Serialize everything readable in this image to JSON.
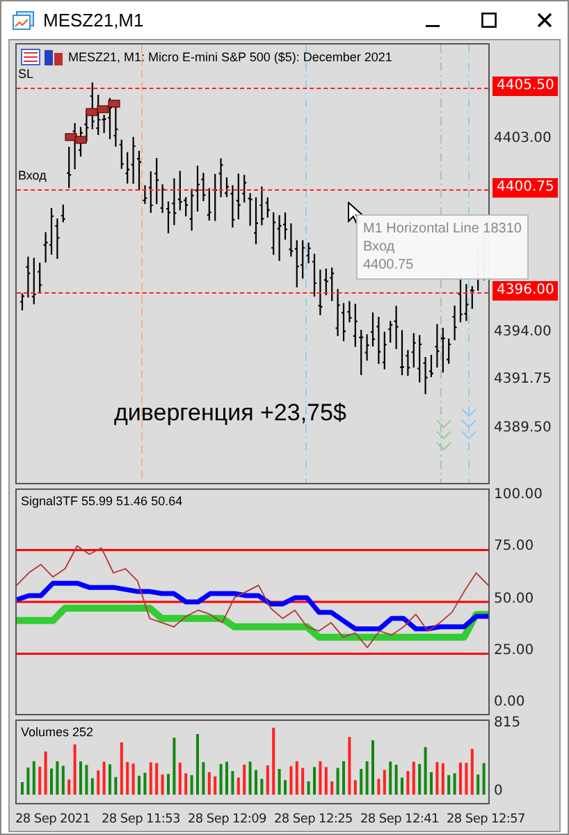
{
  "window": {
    "title": "MESZ21,M1"
  },
  "chart": {
    "header": "MESZ21, M1:  Micro E-mini S&P 500 ($5): December 2021",
    "price_ticks": [
      "4403.00",
      "4394.00",
      "4391.75",
      "4389.50"
    ],
    "lines": [
      {
        "label": "SL",
        "price": "4405.50"
      },
      {
        "label": "Вход",
        "price": "4400.75"
      },
      {
        "price": "4396.00"
      }
    ],
    "tooltip": [
      "M1 Horizontal Line 18310",
      "Вход",
      "4400.75"
    ],
    "annotation": "дивергенция +23,75$"
  },
  "indicator": {
    "chart_data": {
      "type": "line",
      "title": "Signal3TF 55.99 51.46 50.64",
      "grid": true,
      "ylim": [
        -4,
        104
      ],
      "yticks": [
        {
          "value": 100,
          "label": "100.00"
        },
        {
          "value": 75,
          "label": "75.00"
        },
        {
          "value": 50,
          "label": "50.00"
        },
        {
          "value": 25,
          "label": "25.00"
        },
        {
          "value": 0,
          "label": "0.00"
        }
      ],
      "series": [
        {
          "color": "#33cc33",
          "values": [
            41,
            41,
            41,
            41,
            47,
            47,
            47,
            47,
            47,
            47,
            47,
            47,
            42,
            42,
            42,
            42,
            42,
            42,
            38,
            38,
            38,
            38,
            38,
            38,
            38,
            33,
            33,
            33,
            33,
            33,
            33,
            33,
            33,
            33,
            33,
            33,
            33,
            33,
            44,
            44
          ]
        },
        {
          "color": "#0000ff",
          "values": [
            51,
            53,
            53,
            59,
            59,
            59,
            57,
            57,
            57,
            56,
            55,
            55,
            54,
            54,
            50,
            50,
            54,
            54,
            54,
            53,
            53,
            49,
            49,
            52,
            52,
            45,
            45,
            41,
            37,
            37,
            37,
            42,
            42,
            37,
            37,
            38,
            38,
            38,
            43,
            43
          ]
        },
        {
          "color": "#bb3333",
          "values": [
            58,
            64,
            68,
            62,
            66,
            77,
            73,
            76,
            64,
            66,
            60,
            42,
            40,
            38,
            43,
            46,
            44,
            40,
            52,
            55,
            58,
            47,
            42,
            46,
            38,
            36,
            40,
            33,
            35,
            28,
            36,
            34,
            38,
            44,
            36,
            40,
            45,
            55,
            64,
            58
          ]
        }
      ]
    }
  },
  "volumes": {
    "title": "Volumes 252",
    "ticks": [
      "815",
      "0"
    ]
  },
  "time_axis": [
    "28 Sep 2021",
    "28 Sep 11:53",
    "28 Sep 12:09",
    "28 Sep 12:25",
    "28 Sep 12:41",
    "28 Sep 12:57"
  ]
}
